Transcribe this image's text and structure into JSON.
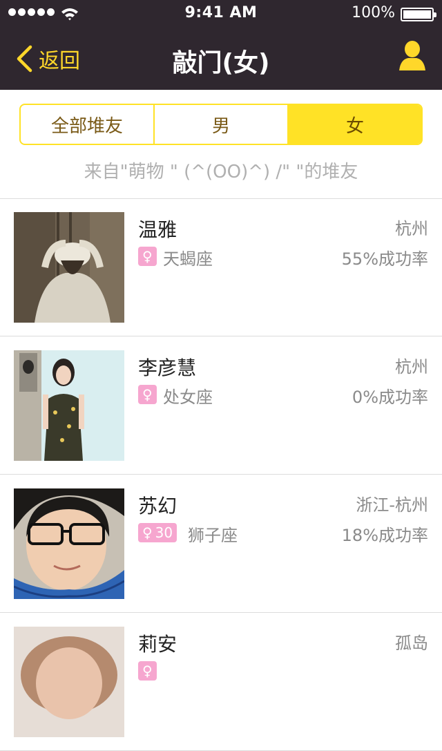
{
  "status_bar": {
    "time": "9:41 AM",
    "battery": "100%"
  },
  "nav": {
    "back_label": "返回",
    "title": "敲门(女)"
  },
  "segments": [
    "全部堆友",
    "男",
    "女"
  ],
  "selected_segment": "女",
  "subtitle": "来自\"萌物 \" (^(OO)^) /\" \"的堆友",
  "colors": {
    "nav_bg": "#2f272f",
    "accent": "#ffe226",
    "gender_badge": "#f6a6cf"
  },
  "users": [
    {
      "name": "温雅",
      "city": "杭州",
      "gender_icon": "female-icon",
      "age": "",
      "zodiac": "天蝎座",
      "rate": "55%成功率"
    },
    {
      "name": "李彦慧",
      "city": "杭州",
      "gender_icon": "female-icon",
      "age": "",
      "zodiac": "处女座",
      "rate": "0%成功率"
    },
    {
      "name": "苏幻",
      "city": "浙江-杭州",
      "gender_icon": "female-icon",
      "age": "30",
      "zodiac": "狮子座",
      "rate": "18%成功率"
    },
    {
      "name": "莉安",
      "city": "孤岛",
      "gender_icon": "female-icon",
      "age": "",
      "zodiac": "",
      "rate": ""
    }
  ]
}
